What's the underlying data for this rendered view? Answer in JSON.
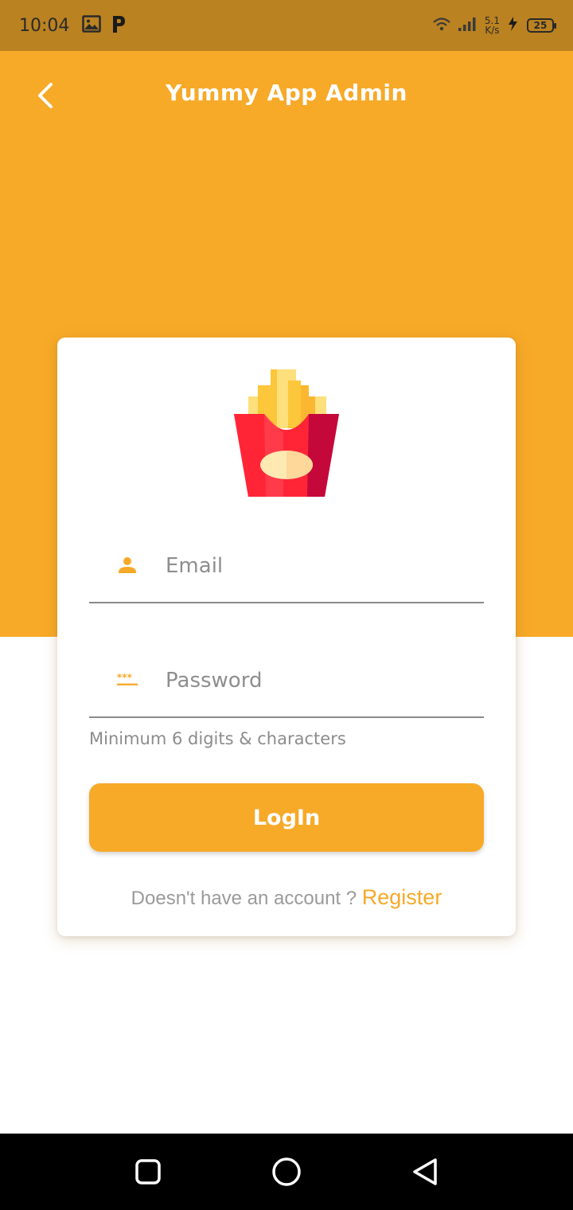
{
  "status_bar": {
    "time": "10:04",
    "net_speed_value": "5.1",
    "net_speed_unit": "K/s",
    "battery_level": "25",
    "icons": [
      "image-icon",
      "p-app-icon",
      "wifi-icon",
      "signal-icon",
      "charging-icon",
      "battery-icon"
    ]
  },
  "header": {
    "title": "Yummy App Admin",
    "back_icon": "chevron-left-icon"
  },
  "login_form": {
    "logo_icon": "french-fries-icon",
    "email": {
      "placeholder": "Email",
      "value": "",
      "icon": "person-icon"
    },
    "password": {
      "placeholder": "Password",
      "value": "",
      "icon": "password-icon"
    },
    "helper_text": "Minimum 6 digits & characters",
    "login_label": "LogIn",
    "register_prompt": "Doesn't have an account ? ",
    "register_link": "Register"
  },
  "nav_bar": {
    "icons": [
      "recent-apps-icon",
      "home-icon",
      "back-icon"
    ]
  },
  "colors": {
    "accent": "#F7A928",
    "status_bar": "#BA8221",
    "fries_box": "#FF2537",
    "fries": "#FCC73A"
  }
}
